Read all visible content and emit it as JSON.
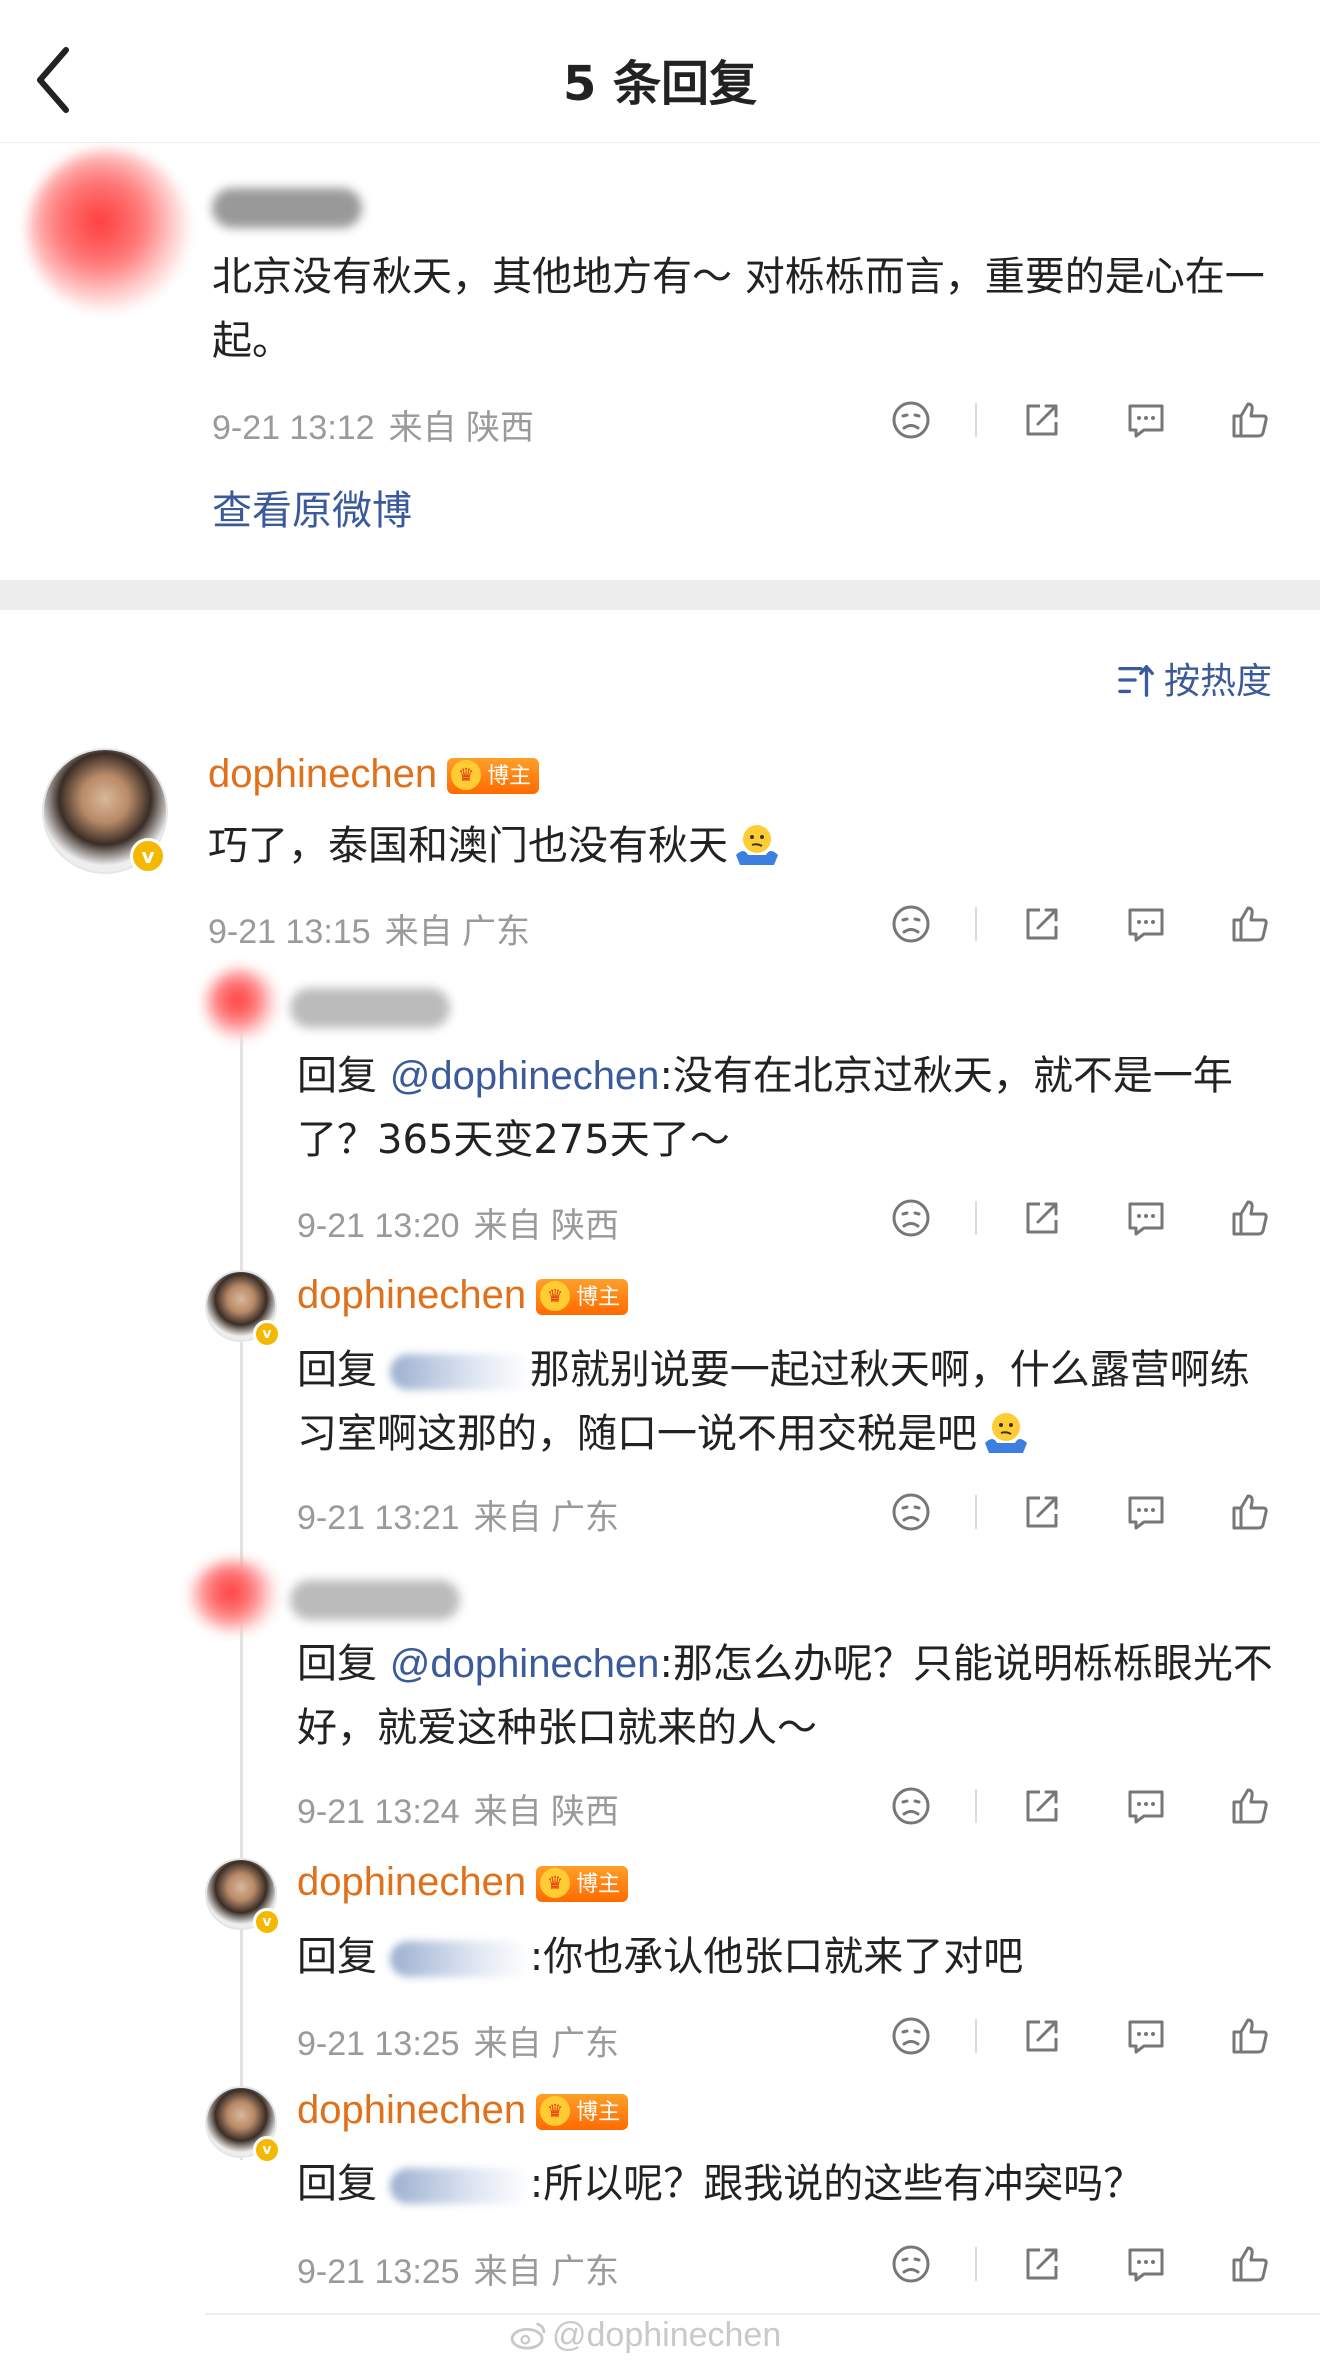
{
  "header": {
    "title": "5 条回复",
    "back_icon": "chevron-left-icon"
  },
  "original": {
    "text": "北京没有秋天，其他地方有～ 对栎栎而言，重要的是心在一起。",
    "time": "9-21 13:12",
    "source": "来自 陕西",
    "view_original": "查看原微博"
  },
  "sort_label": "按热度",
  "main_comment": {
    "username": "dophinechen",
    "badge": "博主",
    "text": "巧了，泰国和澳门也没有秋天",
    "time": "9-21 13:15",
    "source": "来自 广东"
  },
  "replies": [
    {
      "prefix": "回复 ",
      "mention": "@dophinechen",
      "text": ":没有在北京过秋天，就不是一年了？365天变275天了～",
      "time": "9-21 13:20",
      "source": "来自 陕西"
    },
    {
      "username": "dophinechen",
      "badge": "博主",
      "prefix": "回复 ",
      "text": "那就别说要一起过秋天啊，什么露营啊练习室啊这那的，随口一说不用交税是吧",
      "time": "9-21 13:21",
      "source": "来自 广东"
    },
    {
      "prefix": "回复 ",
      "mention": "@dophinechen",
      "text": ":那怎么办呢？只能说明栎栎眼光不好，就爱这种张口就来的人～",
      "time": "9-21 13:24",
      "source": "来自 陕西"
    },
    {
      "username": "dophinechen",
      "badge": "博主",
      "prefix": "回复 ",
      "text": ":你也承认他张口就来了对吧",
      "time": "9-21 13:25",
      "source": "来自 广东"
    },
    {
      "username": "dophinechen",
      "badge": "博主",
      "prefix": "回复 ",
      "text": ":所以呢？跟我说的这些有冲突吗？",
      "time": "9-21 13:25",
      "source": "来自 广东"
    }
  ],
  "watermark": "@dophinechen",
  "colors": {
    "username": "#e0701a",
    "link": "#3a5a9b",
    "meta": "#9a9a9a",
    "verified": "#f5b800"
  }
}
